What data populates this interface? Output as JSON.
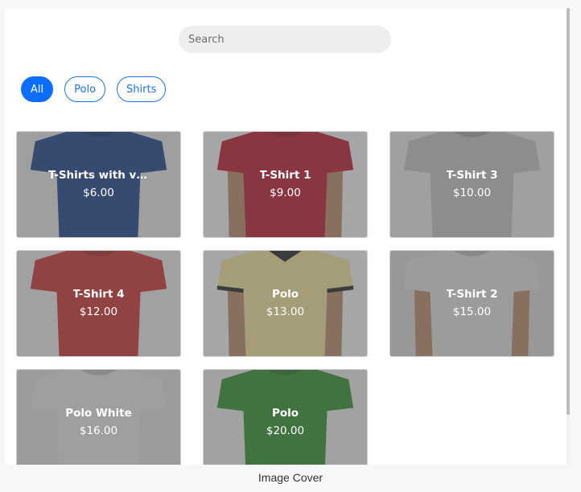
{
  "search": {
    "placeholder": "Search"
  },
  "filters": [
    {
      "label": "All",
      "active": true
    },
    {
      "label": "Polo",
      "active": false
    },
    {
      "label": "Shirts",
      "active": false
    }
  ],
  "products": [
    {
      "title": "T-Shirts with va...",
      "price": "$6.00",
      "color": "#173f86",
      "bg": "#dedede",
      "style": "tshirt",
      "model": false
    },
    {
      "title": "T-Shirt 1",
      "price": "$9.00",
      "color": "#b5162b",
      "bg": "#ececec",
      "style": "tshirt",
      "model": true
    },
    {
      "title": "T-Shirt 3",
      "price": "$10.00",
      "color": "#bdbdbd",
      "bg": "#e0e0e0",
      "style": "tshirt",
      "model": false
    },
    {
      "title": "T-Shirt 4",
      "price": "$12.00",
      "color": "#c42e2e",
      "bg": "#e2e2e2",
      "style": "tshirt",
      "model": false
    },
    {
      "title": "Polo",
      "price": "$13.00",
      "color": "#eadb93",
      "bg": "#ececec",
      "style": "polo",
      "model": true
    },
    {
      "title": "T-Shirt 2",
      "price": "$15.00",
      "color": "#d9d9d9",
      "bg": "#d2d2d2",
      "style": "tshirt",
      "model": true
    },
    {
      "title": "Polo White",
      "price": "$16.00",
      "color": "#dedede",
      "bg": "#d6d6d6",
      "style": "tshirt",
      "model": false
    },
    {
      "title": "Polo",
      "price": "$20.00",
      "color": "#2b8a2b",
      "bg": "#e4e4e4",
      "style": "tshirt",
      "model": false
    }
  ],
  "caption": "Image Cover"
}
